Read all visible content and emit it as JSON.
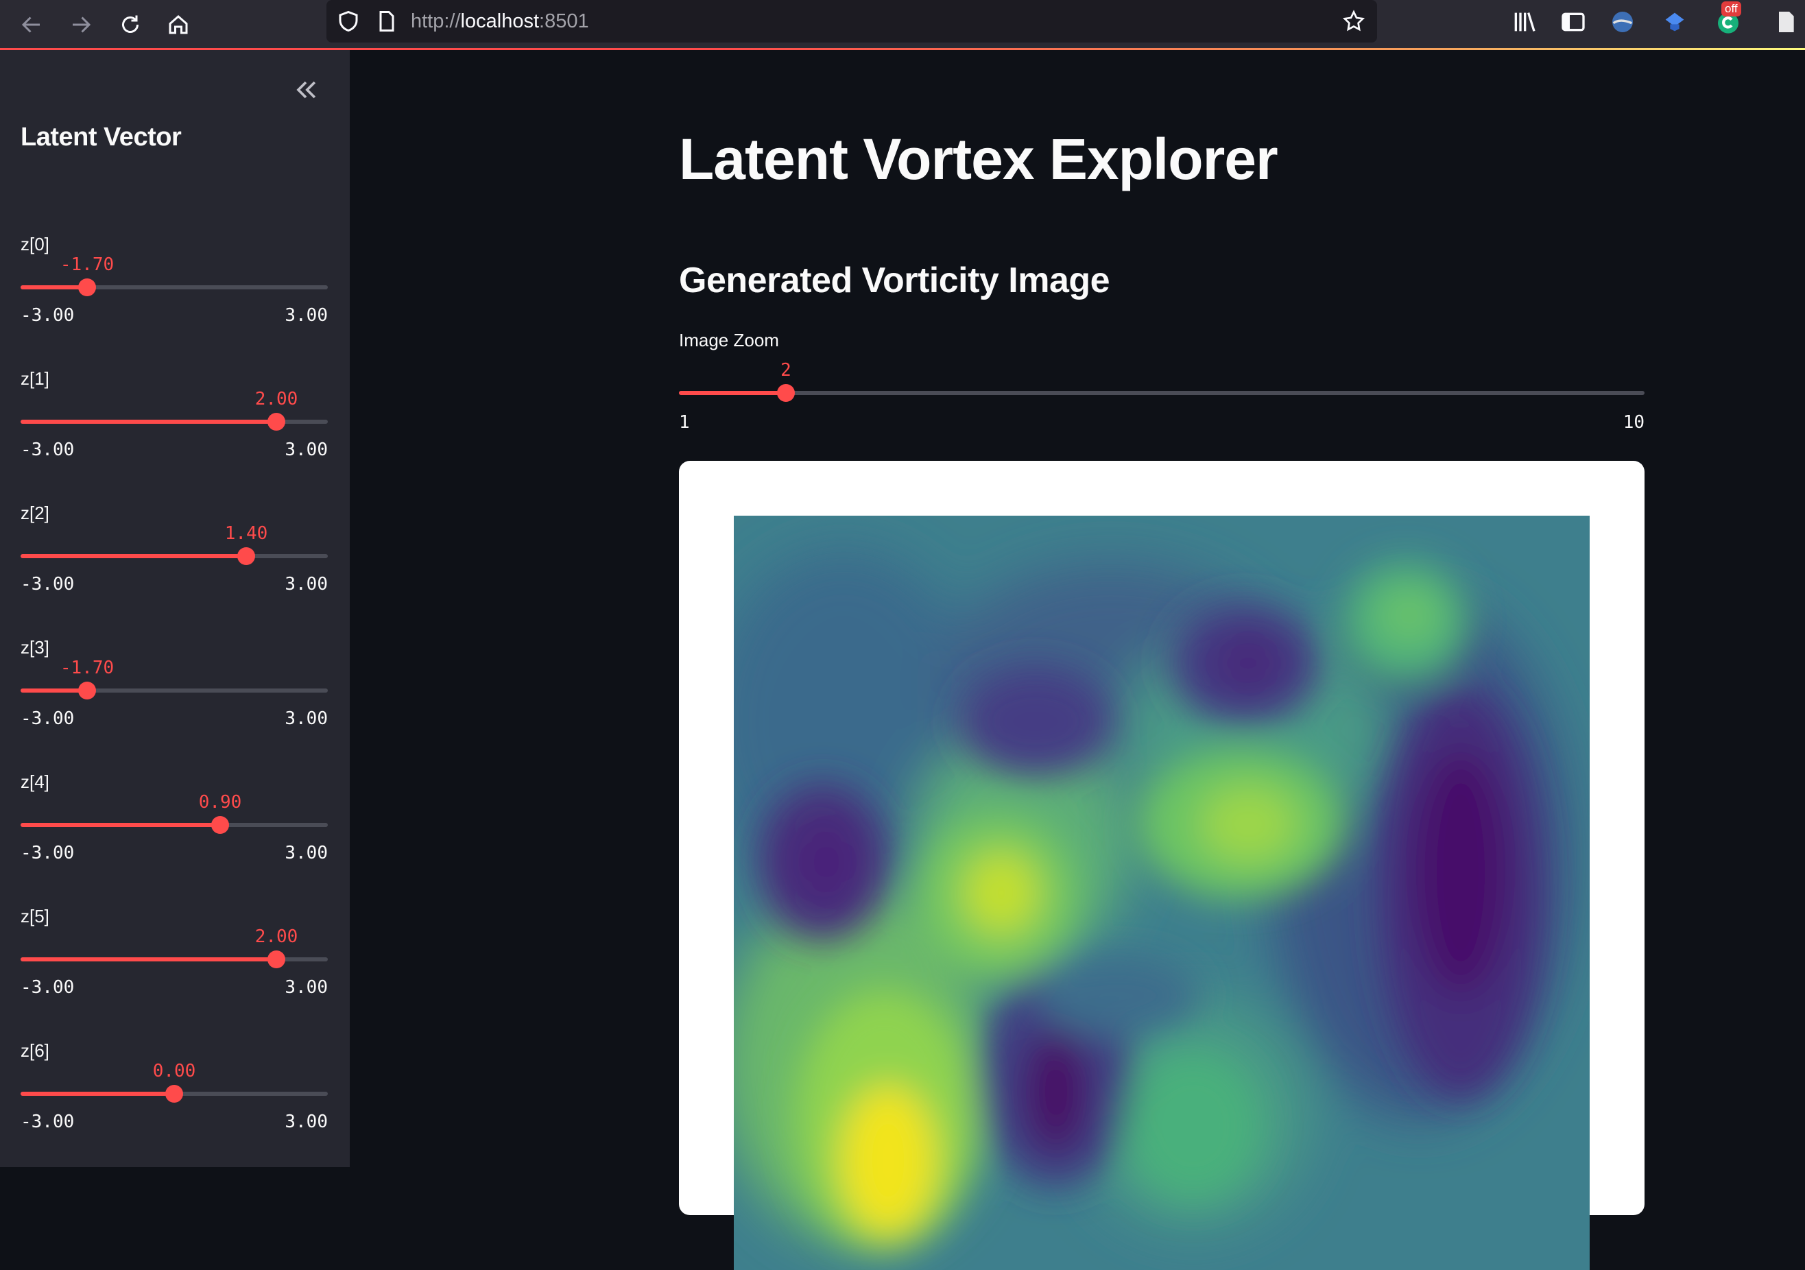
{
  "browser": {
    "url_scheme": "http://",
    "url_host": "localhost",
    "url_port": ":8501",
    "icons": [
      "back-arrow-icon",
      "forward-arrow-icon",
      "reload-icon",
      "home-icon",
      "shield-icon",
      "page-icon",
      "star-icon",
      "library-icon",
      "sidebar-toggle-icon",
      "extension-icon",
      "extension-icon",
      "extension-icon",
      "reader-icon"
    ],
    "off_badge": "off"
  },
  "sidebar": {
    "collapse_icon": "double-chevron-left-icon",
    "title": "Latent Vector",
    "sliders": [
      {
        "label": "z[0]",
        "value": "-1.70",
        "numeric": -1.7,
        "min": "-3.00",
        "max": "3.00"
      },
      {
        "label": "z[1]",
        "value": "2.00",
        "numeric": 2.0,
        "min": "-3.00",
        "max": "3.00"
      },
      {
        "label": "z[2]",
        "value": "1.40",
        "numeric": 1.4,
        "min": "-3.00",
        "max": "3.00"
      },
      {
        "label": "z[3]",
        "value": "-1.70",
        "numeric": -1.7,
        "min": "-3.00",
        "max": "3.00"
      },
      {
        "label": "z[4]",
        "value": "0.90",
        "numeric": 0.9,
        "min": "-3.00",
        "max": "3.00"
      },
      {
        "label": "z[5]",
        "value": "2.00",
        "numeric": 2.0,
        "min": "-3.00",
        "max": "3.00"
      },
      {
        "label": "z[6]",
        "value": "0.00",
        "numeric": 0.0,
        "min": "-3.00",
        "max": "3.00"
      }
    ]
  },
  "main": {
    "title": "Latent Vortex Explorer",
    "subheader": "Generated Vorticity Image",
    "zoom": {
      "label": "Image Zoom",
      "value": "2",
      "numeric": 2,
      "min": "1",
      "max": "10"
    }
  },
  "colors": {
    "accent": "#ff4b4b",
    "background": "#0e1117",
    "sidebar": "#262730"
  }
}
